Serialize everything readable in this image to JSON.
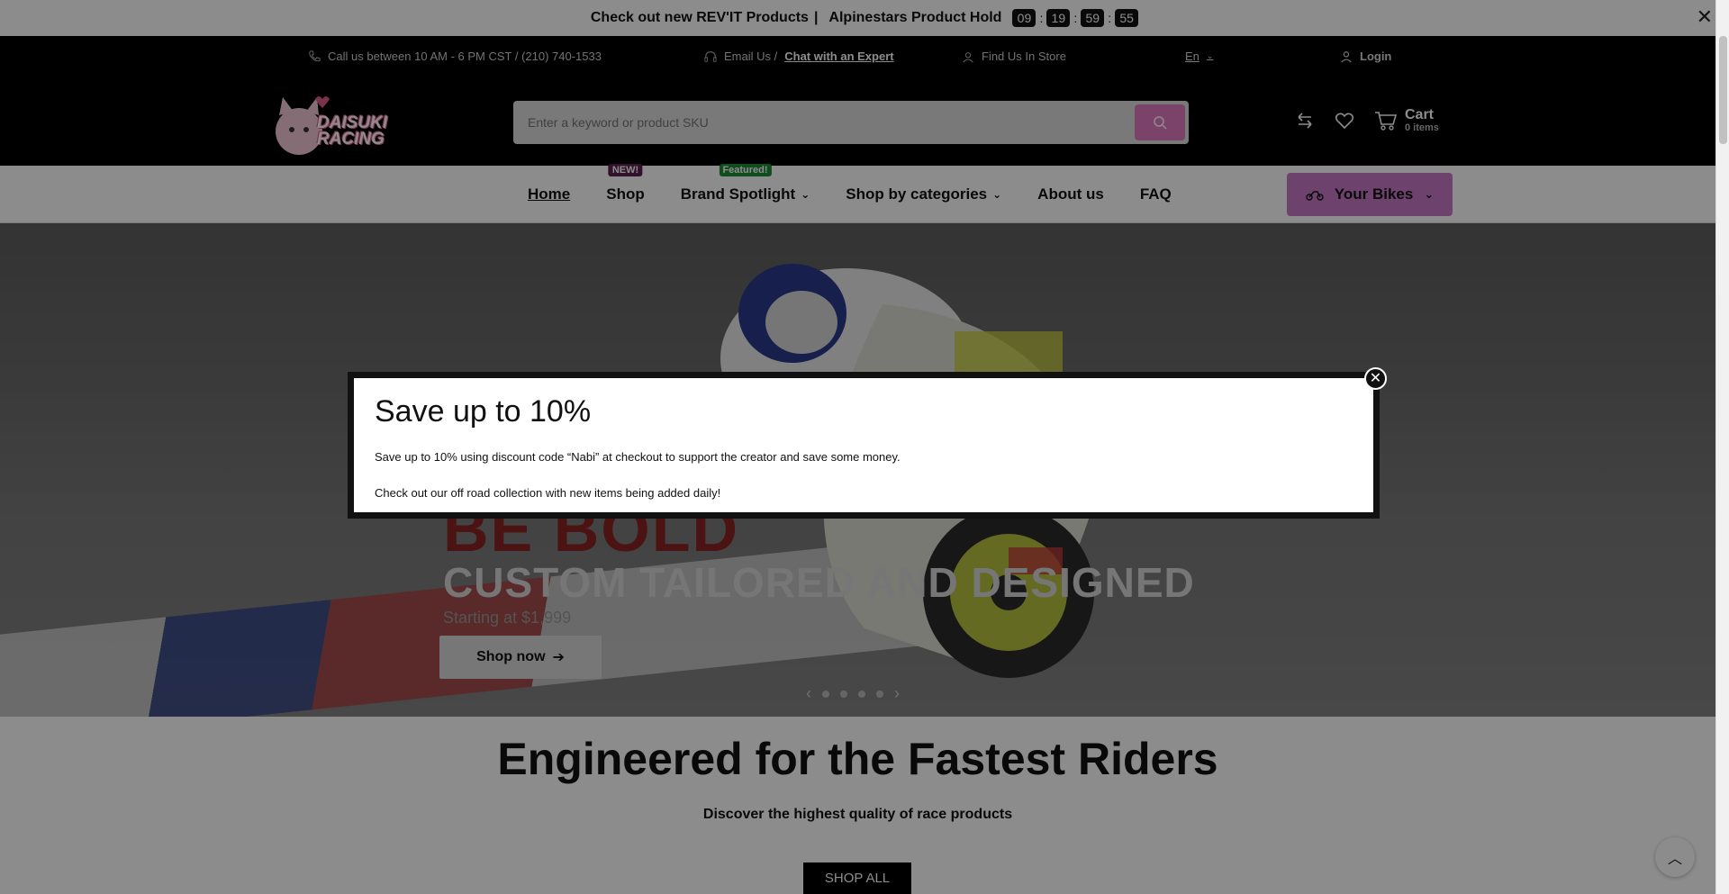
{
  "announcement": {
    "text1": "Check out new REV'IT Products",
    "separator": "|",
    "text2": "Alpinestars Product Hold",
    "timer": [
      "09",
      "19",
      "59",
      "55"
    ],
    "close_icon": "close-icon"
  },
  "infobar": {
    "call": "Call us between 10 AM - 6 PM CST / (210) 740-1533",
    "email_prefix": "Email Us /",
    "chat_link": "Chat with an Expert",
    "store": "Find Us In Store",
    "language": "En",
    "login": "Login"
  },
  "header": {
    "logo_text_line1": "DAISUKI",
    "logo_text_line2": "RACING",
    "search_placeholder": "Enter a keyword or product SKU",
    "cart_label": "Cart",
    "cart_count": "0 items"
  },
  "nav": {
    "items": [
      {
        "label": "Home",
        "active": true,
        "badge": ""
      },
      {
        "label": "Shop",
        "badge": "NEW!",
        "badge_color": "#5c1f4f"
      },
      {
        "label": "Brand Spotlight",
        "badge": "Featured!",
        "badge_color": "#1f8a3a",
        "dropdown": true
      },
      {
        "label": "Shop by categories",
        "dropdown": true
      },
      {
        "label": "About us"
      },
      {
        "label": "FAQ"
      }
    ],
    "your_bikes": "Your Bikes"
  },
  "hero": {
    "headline1": "BE BOLD",
    "headline2": "CUSTOM TAILORED AND DESIGNED",
    "price": "Starting at $1,999",
    "button": "Shop now",
    "slides": 4
  },
  "modal": {
    "title": "Save up to 10%",
    "line1": "Save up to 10% using discount code “Nabi” at checkout to support the creator and save some money.",
    "line2": "Check out our off road collection with new items being added daily!"
  },
  "section": {
    "title": "Engineered for the Fastest Riders",
    "subtitle": "Discover the highest quality of race products",
    "button": "SHOP ALL"
  },
  "colors": {
    "accent_pink": "#e07bbf",
    "bikes_button": "#c77bc8",
    "black": "#000000"
  }
}
